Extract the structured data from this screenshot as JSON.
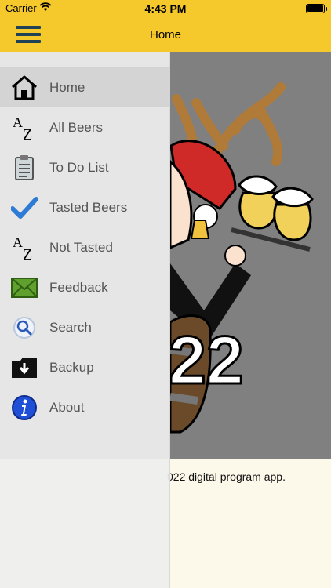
{
  "status_bar": {
    "carrier": "Carrier",
    "time": "4:43 PM"
  },
  "nav": {
    "title": "Home",
    "menu_icon": "hamburger-icon"
  },
  "main": {
    "caption": "022 digital program app.",
    "poster_text": "22"
  },
  "drawer": {
    "items": [
      {
        "label": "Home",
        "icon": "home-icon",
        "active": true
      },
      {
        "label": "All Beers",
        "icon": "az-sort-icon"
      },
      {
        "label": "To Do List",
        "icon": "clipboard-icon"
      },
      {
        "label": "Tasted Beers",
        "icon": "checkmark-icon"
      },
      {
        "label": "Not Tasted",
        "icon": "az-sort-icon"
      },
      {
        "label": "Feedback",
        "icon": "envelope-icon"
      },
      {
        "label": "Search",
        "icon": "magnifier-icon"
      },
      {
        "label": "Backup",
        "icon": "folder-download-icon"
      },
      {
        "label": "About",
        "icon": "info-icon"
      }
    ]
  },
  "colors": {
    "header": "#f5c82b",
    "hero_bg": "#808080",
    "page_bg": "#fdf9ea",
    "drawer_bg": "#eeeeee",
    "menu_icon": "#1f4256"
  }
}
